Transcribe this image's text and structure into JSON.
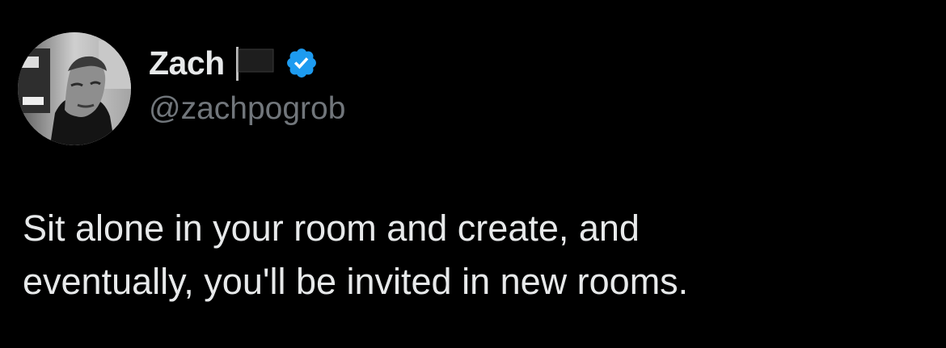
{
  "tweet": {
    "author": {
      "display_name": "Zach",
      "handle": "@zachpogrob",
      "avatar_icon": "profile-photo",
      "flag_icon": "black-flag-icon",
      "verified_icon": "verified-badge-icon"
    },
    "text": "Sit alone in your room and create, and\neventually, you'll be invited in new rooms."
  },
  "colors": {
    "background": "#000000",
    "primary_text": "#e7e9ea",
    "secondary_text": "#71767b",
    "verified_blue": "#1d9bf0"
  }
}
